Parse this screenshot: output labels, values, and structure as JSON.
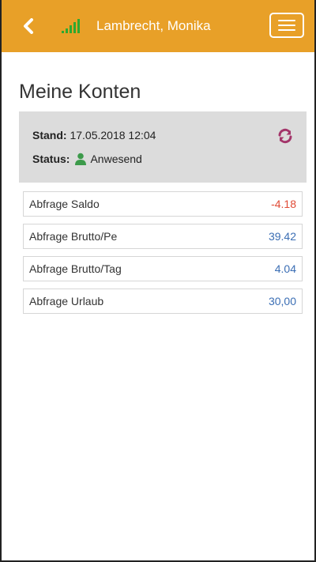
{
  "header": {
    "title": "Lambrecht, Monika",
    "back_icon": "chevron-left-icon",
    "signal_icon": "signal-strength-icon",
    "menu_icon": "hamburger-menu-icon",
    "color": "#e8a028"
  },
  "main": {
    "title": "Meine Konten"
  },
  "status_panel": {
    "stand_label": "Stand:",
    "stand_value": "17.05.2018 12:04",
    "status_label": "Status:",
    "status_value": "Anwesend",
    "status_icon": "person-icon",
    "refresh_icon": "refresh-icon"
  },
  "accounts": [
    {
      "label": "Abfrage Saldo",
      "value": "-4.18",
      "color": "#e04a35"
    },
    {
      "label": "Abfrage Brutto/Pe",
      "value": "39.42",
      "color": "#3b6eb4"
    },
    {
      "label": "Abfrage Brutto/Tag",
      "value": "4.04",
      "color": "#3b6eb4"
    },
    {
      "label": "Abfrage Urlaub",
      "value": "30,00",
      "color": "#3b6eb4"
    }
  ]
}
